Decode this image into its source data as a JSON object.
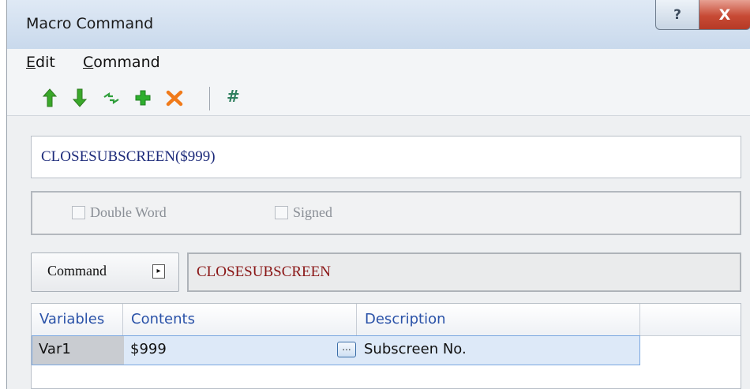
{
  "window": {
    "title": "Macro Command",
    "help_glyph": "?",
    "close_glyph": "X"
  },
  "menu": [
    {
      "accel": "E",
      "rest": "dit"
    },
    {
      "accel": "C",
      "rest": "ommand"
    }
  ],
  "toolbar": {
    "icons": [
      "move-up-icon",
      "move-down-icon",
      "replace-icon",
      "add-icon",
      "delete-icon"
    ],
    "hash": "#"
  },
  "expression": "CLOSESUBSCREEN($999)",
  "options": {
    "double_word": "Double Word",
    "signed": "Signed"
  },
  "command": {
    "label": "Command",
    "arrow": "▸",
    "name": "CLOSESUBSCREEN"
  },
  "grid": {
    "columns": [
      "Variables",
      "Contents",
      "Description"
    ],
    "rows": [
      {
        "variable": "Var1",
        "contents": "$999",
        "browse": "...",
        "description": "Subscreen No."
      }
    ]
  },
  "colors": {
    "up_arrow": "#3aa82a",
    "down_arrow": "#3aa82a",
    "add": "#2eae2e",
    "delete": "#f07a1a",
    "command_name": "#8a1616",
    "expression": "#1c2a7a"
  }
}
